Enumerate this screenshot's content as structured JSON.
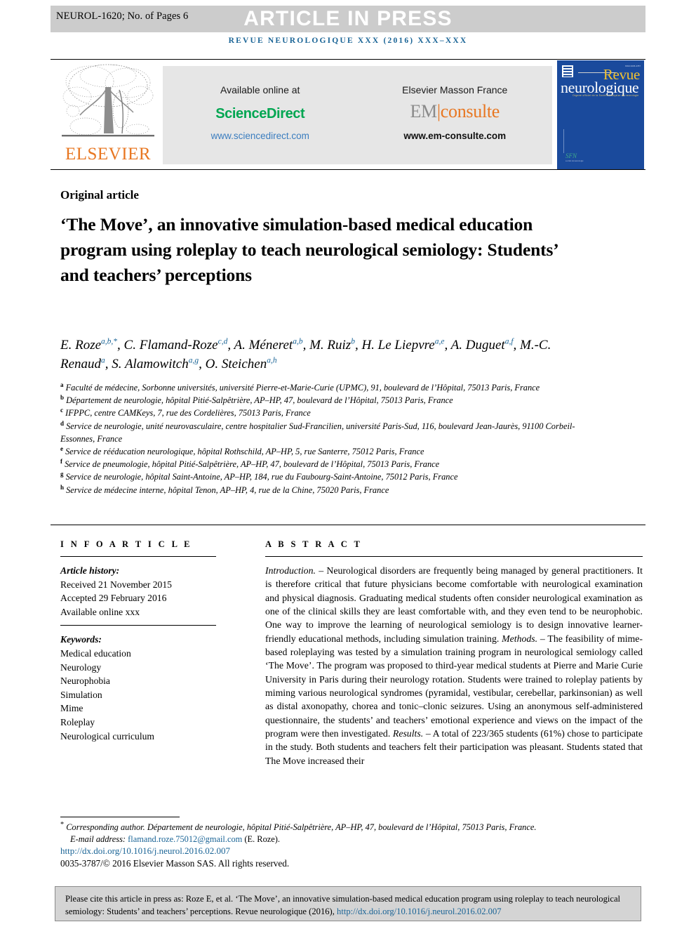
{
  "header": {
    "article_code": "NEUROL-1620; No. of Pages 6",
    "banner_text": "ARTICLE IN PRESS",
    "journal_line": "REVUE NEUROLOGIQUE XXX (2016) XXX–XXX",
    "banner_bg": "#cccccc",
    "journal_color": "#1a6496"
  },
  "logos": {
    "elsevier_word": "ELSEVIER",
    "elsevier_color": "#E87722",
    "available_online": "Available online at",
    "sciencedirect": "ScienceDirect",
    "sciencedirect_color": "#00a651",
    "sciencedirect_url": "www.sciencedirect.com",
    "elsevier_masson": "Elsevier Masson France",
    "em_prefix": "EM",
    "em_suffix": "consulte",
    "em_url": "www.em-consulte.com",
    "cover": {
      "revue": "Revue",
      "neurologique": "neurologique",
      "subtitle": "Organe officiel de la Société française de neurologie",
      "sfn": "SFN",
      "sfn_sub": "société de neurologie",
      "bg": "#1a4a9c",
      "revue_color": "#f2c230"
    }
  },
  "article": {
    "type_label": "Original article",
    "title": "‘The Move’, an innovative simulation-based medical education program using roleplay to teach neurological semiology: Students’ and teachers’ perceptions"
  },
  "authors": [
    {
      "name": "E. Roze",
      "sup": "a,b,*"
    },
    {
      "name": "C. Flamand-Roze",
      "sup": "c,d"
    },
    {
      "name": "A. Méneret",
      "sup": "a,b"
    },
    {
      "name": "M. Ruiz",
      "sup": "b"
    },
    {
      "name": "H. Le Liepvre",
      "sup": "a,e"
    },
    {
      "name": "A. Duguet",
      "sup": "a,f"
    },
    {
      "name": "M.-C. Renaud",
      "sup": "a"
    },
    {
      "name": "S. Alamowitch",
      "sup": "a,g"
    },
    {
      "name": "O. Steichen",
      "sup": "a,h"
    }
  ],
  "affiliations": [
    {
      "key": "a",
      "text": "Faculté de médecine, Sorbonne universités, université Pierre-et-Marie-Curie (UPMC), 91, boulevard de l’Hôpital, 75013 Paris, France"
    },
    {
      "key": "b",
      "text": "Département de neurologie, hôpital Pitié-Salpêtrière, AP–HP, 47, boulevard de l’Hôpital, 75013 Paris, France"
    },
    {
      "key": "c",
      "text": "IFPPC, centre CAMKeys, 7, rue des Cordelières, 75013 Paris, France"
    },
    {
      "key": "d",
      "text": "Service de neurologie, unité neurovasculaire, centre hospitalier Sud-Francilien, université Paris-Sud, 116, boulevard Jean-Jaurès, 91100 Corbeil-Essonnes, France"
    },
    {
      "key": "e",
      "text": "Service de rééducation neurologique, hôpital Rothschild, AP–HP, 5, rue Santerre, 75012 Paris, France"
    },
    {
      "key": "f",
      "text": "Service de pneumologie, hôpital Pitié-Salpêtrière, AP–HP, 47, boulevard de l’Hôpital, 75013 Paris, France"
    },
    {
      "key": "g",
      "text": "Service de neurologie, hôpital Saint-Antoine, AP–HP, 184, rue du Faubourg-Saint-Antoine, 75012 Paris, France"
    },
    {
      "key": "h",
      "text": "Service de médecine interne, hôpital Tenon, AP–HP, 4, rue de la Chine, 75020 Paris, France"
    }
  ],
  "info_article": {
    "heading": "I N F O   A R T I C L E",
    "history_label": "Article history:",
    "history": [
      "Received 21 November 2015",
      "Accepted 29 February 2016",
      "Available online xxx"
    ],
    "keywords_label": "Keywords:",
    "keywords": [
      "Medical education",
      "Neurology",
      "Neurophobia",
      "Simulation",
      "Mime",
      "Roleplay",
      "Neurological curriculum"
    ]
  },
  "abstract": {
    "heading": "A B S T R A C T",
    "sections": [
      {
        "label": "Introduction.",
        "dash": " – ",
        "text": "Neurological disorders are frequently being managed by general practitioners. It is therefore critical that future physicians become comfortable with neurological examination and physical diagnosis. Graduating medical students often consider neurological examination as one of the clinical skills they are least comfortable with, and they even tend to be neurophobic. One way to improve the learning of neurological semiology is to design innovative learner-friendly educational methods, including simulation training."
      },
      {
        "label": "Methods.",
        "dash": " – ",
        "text": "The feasibility of mime-based roleplaying was tested by a simulation training program in neurological semiology called ‘The Move’. The program was proposed to third-year medical students at Pierre and Marie Curie University in Paris during their neurology rotation. Students were trained to roleplay patients by miming various neurological syndromes (pyramidal, vestibular, cerebellar, parkinsonian) as well as distal axonopathy, chorea and tonic–clonic seizures. Using an anonymous self-administered questionnaire, the students’ and teachers’ emotional experience and views on the impact of the program were then investigated."
      },
      {
        "label": "Results.",
        "dash": " – ",
        "text": "A total of 223/365 students (61%) chose to participate in the study. Both students and teachers felt their participation was pleasant. Students stated that The Move increased their"
      }
    ]
  },
  "footnotes": {
    "corresponding_marker": "*",
    "corresponding": "Corresponding author. Département de neurologie, hôpital Pitié-Salpêtrière, AP–HP, 47, boulevard de l’Hôpital, 75013 Paris, France.",
    "email_label": "E-mail address:",
    "email": "flamand.roze.75012@gmail.com",
    "email_suffix": "(E. Roze).",
    "doi": "http://dx.doi.org/10.1016/j.neurol.2016.02.007",
    "copyright": "0035-3787/© 2016 Elsevier Masson SAS. All rights reserved."
  },
  "cite_box": {
    "text": "Please cite this article in press as: Roze E, et al. ‘The Move’, an innovative simulation-based medical education program using roleplay to teach neurological semiology: Students’ and teachers’ perceptions. Revue neurologique (2016), ",
    "link": "http://dx.doi.org/10.1016/j.neurol.2016.02.007"
  }
}
